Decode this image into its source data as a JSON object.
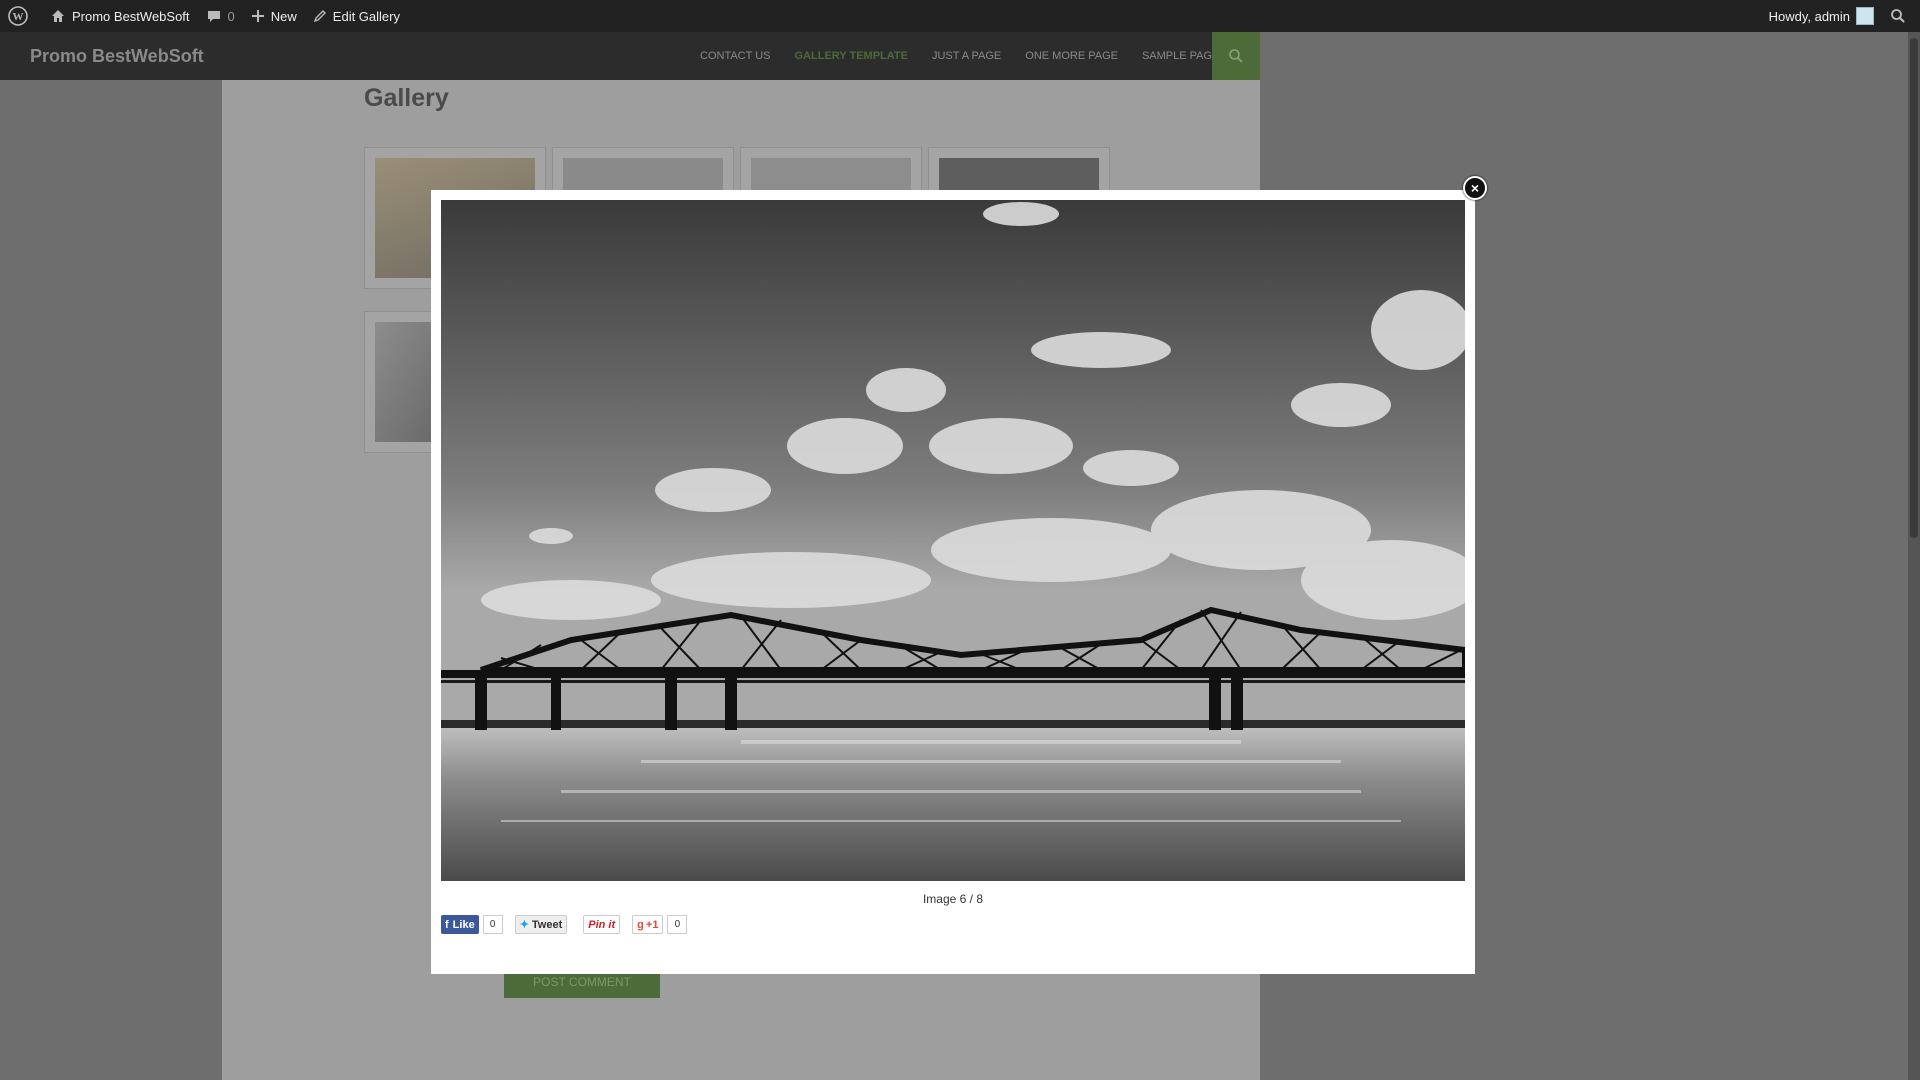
{
  "adminbar": {
    "site_name": "Promo BestWebSoft",
    "comments_count": "0",
    "new_label": "New",
    "edit_label": "Edit Gallery",
    "howdy": "Howdy, admin"
  },
  "header": {
    "site_title": "Promo BestWebSoft",
    "nav": [
      {
        "label": "CONTACT US"
      },
      {
        "label": "GALLERY TEMPLATE",
        "active": true
      },
      {
        "label": "JUST A PAGE"
      },
      {
        "label": "ONE MORE PAGE"
      },
      {
        "label": "SAMPLE PAGE"
      }
    ]
  },
  "page": {
    "title": "Gallery",
    "post_comment": "POST COMMENT"
  },
  "lightbox": {
    "caption": "Image 6 / 8",
    "close_icon": "close-icon",
    "social": {
      "like_label": "Like",
      "like_count": "0",
      "tweet_label": "Tweet",
      "pin_label": "Pin it",
      "gplus_label": "+1",
      "gplus_count": "0"
    }
  },
  "colors": {
    "accent": "#4d6b39",
    "adminbar": "#222222"
  }
}
